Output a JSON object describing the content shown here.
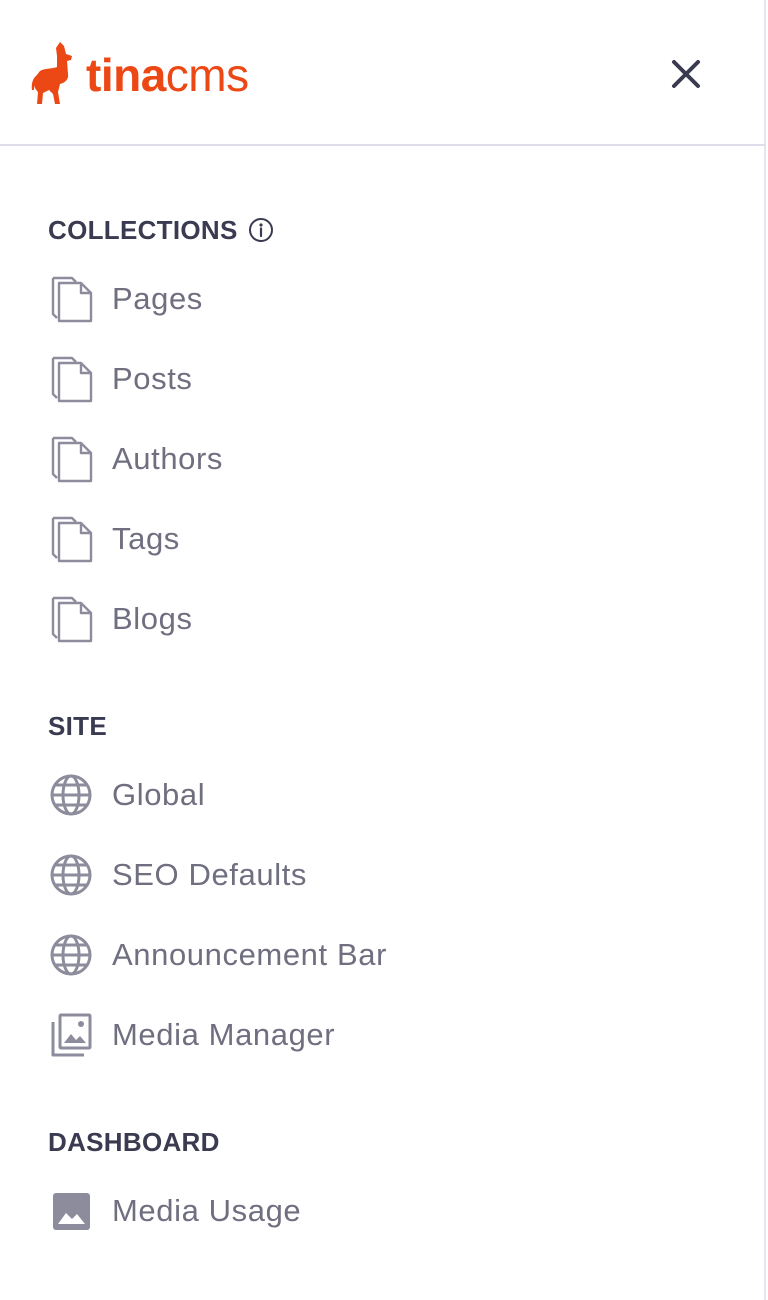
{
  "brand": {
    "name_bold": "tina",
    "name_light": "cms",
    "color": "#ec4815"
  },
  "header": {
    "close_icon": "close-icon"
  },
  "sections": {
    "collections": {
      "title": "COLLECTIONS",
      "info_icon": "info-icon",
      "items": [
        {
          "label": "Pages",
          "icon": "document-copy-icon"
        },
        {
          "label": "Posts",
          "icon": "document-copy-icon"
        },
        {
          "label": "Authors",
          "icon": "document-copy-icon"
        },
        {
          "label": "Tags",
          "icon": "document-copy-icon"
        },
        {
          "label": "Blogs",
          "icon": "document-copy-icon"
        }
      ]
    },
    "site": {
      "title": "SITE",
      "items": [
        {
          "label": "Global",
          "icon": "globe-icon"
        },
        {
          "label": "SEO Defaults",
          "icon": "globe-icon"
        },
        {
          "label": "Announcement Bar",
          "icon": "globe-icon"
        },
        {
          "label": "Media Manager",
          "icon": "image-stack-icon"
        }
      ]
    },
    "dashboard": {
      "title": "DASHBOARD",
      "items": [
        {
          "label": "Media Usage",
          "icon": "image-icon"
        }
      ]
    }
  },
  "colors": {
    "heading": "#3a3a50",
    "item_text": "#6f6f80",
    "icon": "#8c8c9c",
    "divider": "#e1ddec"
  }
}
